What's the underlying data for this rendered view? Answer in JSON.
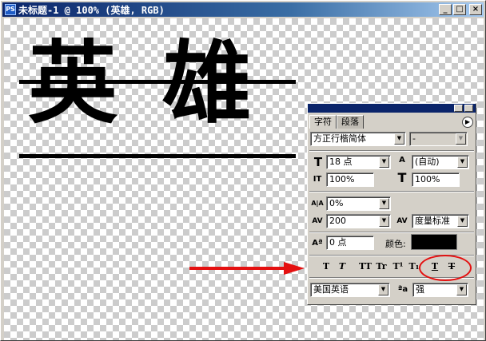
{
  "window": {
    "title": "未标题-1 @ 100% (英雄, RGB)",
    "app_icon": "PS",
    "minimize": "_",
    "maximize": "□",
    "close": "×"
  },
  "canvas": {
    "text": [
      "英",
      "雄"
    ]
  },
  "panel": {
    "tabs": [
      {
        "label": "字符",
        "active": true
      },
      {
        "label": "段落",
        "active": false
      }
    ],
    "menu_arrow": "▶",
    "font_family": "方正行楷简体",
    "font_style": "-",
    "size_icon": "T",
    "size_value": "18 点",
    "leading_icon": "A",
    "leading_value": "(自动)",
    "vscale_icon": "IT",
    "vscale_value": "100%",
    "hscale_icon": "T",
    "hscale_value": "100%",
    "tracking_icon": "A|A",
    "tracking_value": "0%",
    "kerning_icon": "AV",
    "kerning_value": "200",
    "kerning2_icon": "AV",
    "kerning2_value": "度量标准",
    "baseline_icon": "Aª",
    "baseline_value": "0 点",
    "color_label": "颜色:",
    "color_value": "#000000",
    "style_buttons": [
      "T",
      "T",
      "TT",
      "Tr",
      "T¹",
      "T₁",
      "T",
      "T"
    ],
    "language": "美国英语",
    "aa_icon": "ªa",
    "aa_value": "强"
  }
}
